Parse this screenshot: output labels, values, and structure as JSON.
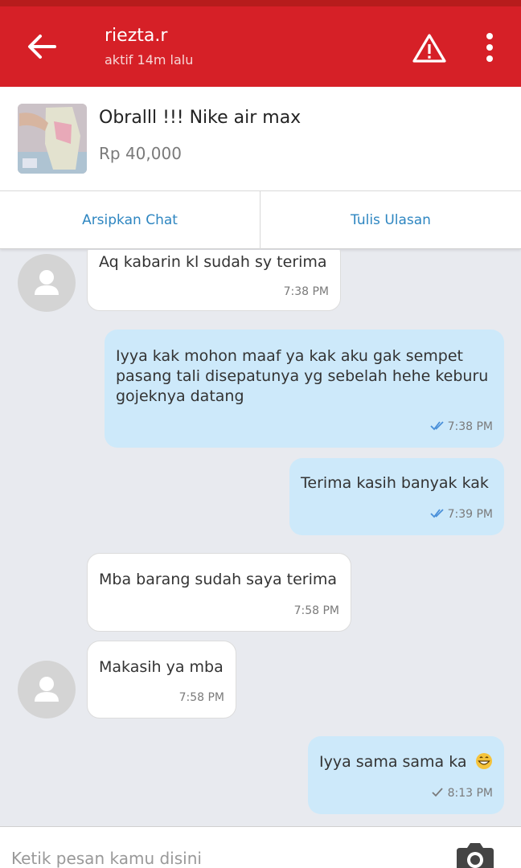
{
  "header": {
    "name": "riezta.r",
    "status": "aktif 14m lalu",
    "color": "#d62027"
  },
  "product": {
    "title": "Obralll !!! Nike air max",
    "price": "Rp 40,000"
  },
  "actions": {
    "archive": "Arsipkan Chat",
    "review": "Tulis Ulasan"
  },
  "messages": [
    {
      "side": "in",
      "avatar": true,
      "lines": [
        "Aq kabarin kl sudah sy terima"
      ],
      "time": "7:38 PM"
    },
    {
      "side": "out",
      "read": true,
      "lines": [
        "Iyya kak mohon maaf ya kak aku gak sempet",
        "pasang tali disepatunya yg sebelah hehe keburu",
        "gojeknya datang"
      ],
      "time": "7:38 PM"
    },
    {
      "side": "out",
      "read": true,
      "lines": [
        "Terima kasih banyak kak"
      ],
      "time": "7:39 PM"
    },
    {
      "side": "in",
      "avatar": false,
      "lines": [
        "Mba barang sudah saya terima"
      ],
      "time": "7:58 PM"
    },
    {
      "side": "in",
      "avatar": true,
      "lines": [
        "Makasih ya mba"
      ],
      "time": "7:58 PM"
    },
    {
      "side": "out",
      "read": false,
      "lines": [
        "Iyya sama sama ka"
      ],
      "emoji": "grinning-face-emoji",
      "time": "8:13 PM"
    }
  ],
  "composer": {
    "placeholder": "Ketik pesan kamu disini"
  },
  "icons": {
    "back": "arrow-left-icon",
    "report": "warning-icon",
    "menu": "more-vertical-icon",
    "camera": "camera-icon",
    "read_color": "#4a90d9"
  }
}
